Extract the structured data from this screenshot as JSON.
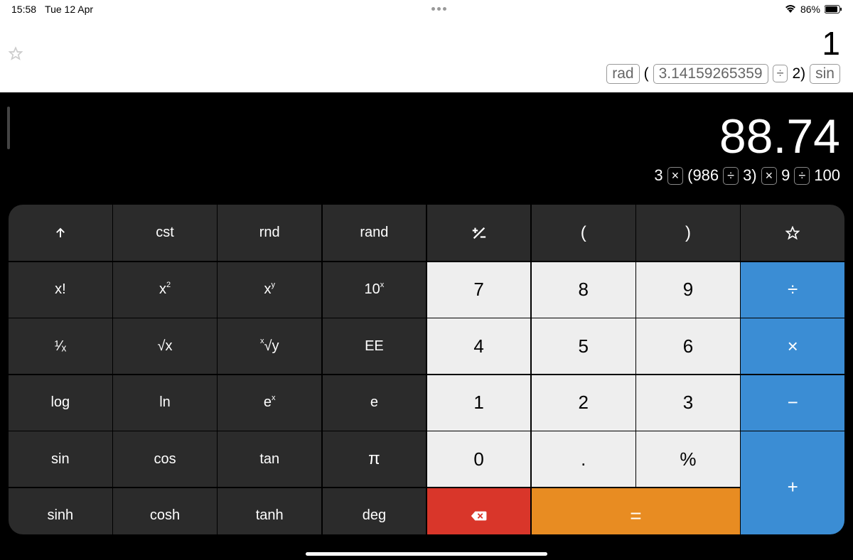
{
  "status": {
    "time": "15:58",
    "date": "Tue 12 Apr",
    "battery": "86%"
  },
  "history": {
    "result": "1",
    "mode": "rad",
    "paren_open": "(",
    "pi_val": "3.14159265359",
    "op_div": "÷",
    "two_paren": "2)",
    "fn_sin": "sin"
  },
  "display": {
    "result": "88.74",
    "e_3": "3",
    "op_mul": "×",
    "e_p986": "(986",
    "op_div": "÷",
    "e_3p": "3)",
    "op_mul2": "×",
    "e_9": "9",
    "op_div2": "÷",
    "e_100": "100"
  },
  "keys": {
    "cst": "cst",
    "rnd": "rnd",
    "rand": "rand",
    "paren_l": "(",
    "paren_r": ")",
    "xfact": "x!",
    "x2": "x",
    "x2_sup": "2",
    "xy": "x",
    "xy_sup": "y",
    "tenx": "10",
    "tenx_sup": "x",
    "inv": "¹⁄ₓ",
    "sqrt": "√x",
    "nroot_sup": "x",
    "nroot": "√y",
    "ee": "EE",
    "log": "log",
    "ln": "ln",
    "ex": "e",
    "ex_sup": "x",
    "e": "e",
    "sin": "sin",
    "cos": "cos",
    "tan": "tan",
    "pi": "π",
    "sinh": "sinh",
    "cosh": "cosh",
    "tanh": "tanh",
    "deg": "deg",
    "n7": "7",
    "n8": "8",
    "n9": "9",
    "n4": "4",
    "n5": "5",
    "n6": "6",
    "n1": "1",
    "n2": "2",
    "n3": "3",
    "n0": "0",
    "dot": ".",
    "pct": "%",
    "div": "÷",
    "mul": "×",
    "sub": "−",
    "add": "+",
    "eq": "="
  }
}
